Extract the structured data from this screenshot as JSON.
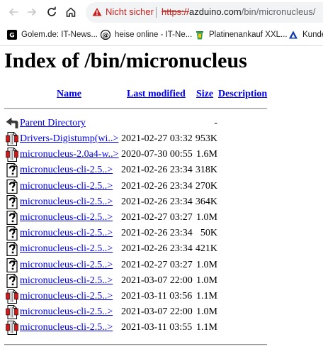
{
  "browser": {
    "security_label": "Nicht sicher",
    "url_scheme": "https://",
    "url_host": "azduino.com",
    "url_path": "/bin/micronucleus/",
    "bookmarks": [
      {
        "label": "Golem.de: IT-News...",
        "icon": "golem-favicon"
      },
      {
        "label": "heise online - IT-Ne...",
        "icon": "heise-favicon"
      },
      {
        "label": "Platinenankauf XXL...",
        "icon": "recycling-bin-favicon"
      },
      {
        "label": "Kunde",
        "icon": "delta-favicon"
      }
    ]
  },
  "listing": {
    "title": "Index of /bin/micronucleus",
    "columns": {
      "name": "Name",
      "modified": "Last modified",
      "size": "Size",
      "description": "Description"
    },
    "parent": {
      "name": "Parent Directory",
      "size": "-"
    },
    "entries": [
      {
        "name": "Drivers-Digistump(wi..>",
        "modified": "2021-02-27 03:32",
        "size": "953K",
        "icon": "compressed"
      },
      {
        "name": "micronucleus-2.0a4-w..>",
        "modified": "2020-07-30 00:55",
        "size": "1.6M",
        "icon": "compressed"
      },
      {
        "name": "micronucleus-cli-2.5..>",
        "modified": "2021-02-26 23:34",
        "size": "318K",
        "icon": "unknown"
      },
      {
        "name": "micronucleus-cli-2.5..>",
        "modified": "2021-02-26 23:34",
        "size": "270K",
        "icon": "unknown"
      },
      {
        "name": "micronucleus-cli-2.5..>",
        "modified": "2021-02-26 23:34",
        "size": "364K",
        "icon": "unknown"
      },
      {
        "name": "micronucleus-cli-2.5..>",
        "modified": "2021-02-27 03:27",
        "size": "1.0M",
        "icon": "unknown"
      },
      {
        "name": "micronucleus-cli-2.5..>",
        "modified": "2021-02-26 23:34",
        "size": "50K",
        "icon": "unknown"
      },
      {
        "name": "micronucleus-cli-2.5..>",
        "modified": "2021-02-26 23:34",
        "size": "421K",
        "icon": "unknown"
      },
      {
        "name": "micronucleus-cli-2.5..>",
        "modified": "2021-02-27 03:27",
        "size": "1.0M",
        "icon": "unknown"
      },
      {
        "name": "micronucleus-cli-2.5..>",
        "modified": "2021-03-07 22:00",
        "size": "1.0M",
        "icon": "unknown"
      },
      {
        "name": "micronucleus-cli-2.5..>",
        "modified": "2021-03-11 03:56",
        "size": "1.1M",
        "icon": "compressed"
      },
      {
        "name": "micronucleus-cli-2.5..>",
        "modified": "2021-03-07 22:00",
        "size": "1.0M",
        "icon": "compressed"
      },
      {
        "name": "micronucleus-cli-2.5..>",
        "modified": "2021-03-11 03:55",
        "size": "1.1M",
        "icon": "compressed"
      }
    ]
  }
}
